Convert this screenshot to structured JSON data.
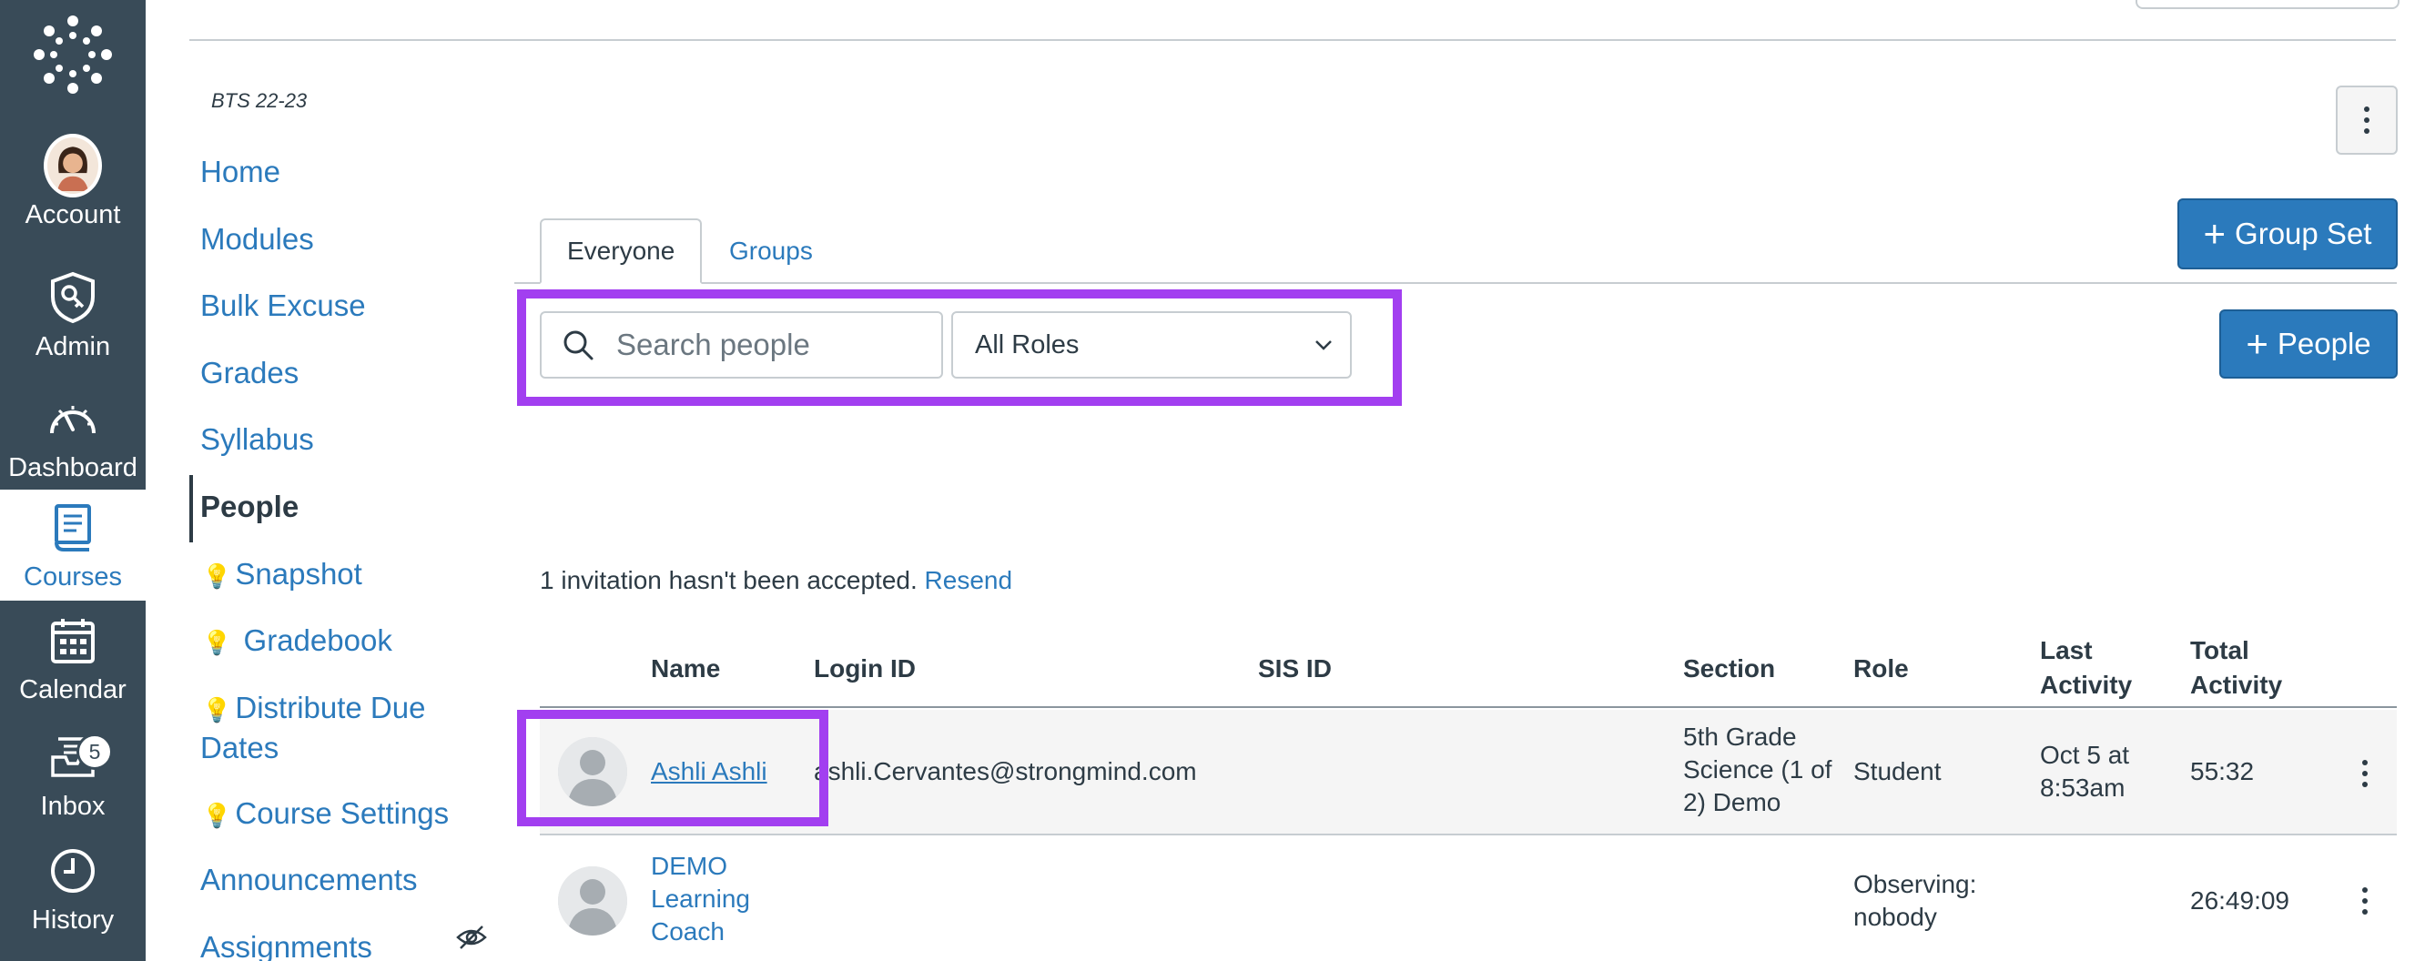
{
  "global_nav": {
    "items": [
      {
        "label": "Account",
        "icon": "avatar"
      },
      {
        "label": "Admin",
        "icon": "admin-shield-icon"
      },
      {
        "label": "Dashboard",
        "icon": "dashboard-gauge-icon"
      },
      {
        "label": "Courses",
        "icon": "courses-book-icon",
        "active": true
      },
      {
        "label": "Calendar",
        "icon": "calendar-icon"
      },
      {
        "label": "Inbox",
        "icon": "inbox-icon",
        "badge": "5"
      },
      {
        "label": "History",
        "icon": "clock-icon"
      }
    ]
  },
  "course": {
    "code": "BTS 22-23",
    "nav": [
      {
        "label": "Home"
      },
      {
        "label": "Modules"
      },
      {
        "label": "Bulk Excuse"
      },
      {
        "label": "Grades"
      },
      {
        "label": "Syllabus"
      },
      {
        "label": "People",
        "active": true
      },
      {
        "label": "Snapshot",
        "bulb": true
      },
      {
        "label": "Gradebook",
        "bulb": true
      },
      {
        "label": "Distribute Due",
        "label2": "Dates",
        "bulb": true
      },
      {
        "label": "Course Settings",
        "bulb": true
      },
      {
        "label": "Announcements"
      },
      {
        "label": "Assignments"
      }
    ]
  },
  "tabs": [
    "Everyone",
    "Groups"
  ],
  "buttons": {
    "group_set": "Group Set",
    "people": "People"
  },
  "search": {
    "placeholder": "Search people",
    "value": ""
  },
  "role_filter": {
    "selected": "All Roles"
  },
  "invitation": {
    "text": "1 invitation hasn't been accepted.",
    "link": "Resend"
  },
  "table": {
    "headers": {
      "name": "Name",
      "login_id": "Login ID",
      "sis_id": "SIS ID",
      "section": "Section",
      "role": "Role",
      "last_activity_1": "Last",
      "last_activity_2": "Activity",
      "total_activity_1": "Total",
      "total_activity_2": "Activity"
    },
    "rows": [
      {
        "name": "Ashli Ashli",
        "login_id": "ashli.Cervantes@strongmind.com",
        "section_1": "5th Grade",
        "section_2": "Science (1 of",
        "section_3": "2) Demo",
        "role": "Student",
        "last_activity_1": "Oct 5 at",
        "last_activity_2": "8:53am",
        "total_activity": "55:32"
      },
      {
        "name_1": "DEMO",
        "name_2": "Learning",
        "name_3": "Coach",
        "role_1": "Observing:",
        "role_2": "nobody",
        "total_activity": "26:49:09"
      }
    ]
  },
  "colors": {
    "nav_bg": "#394b58",
    "link": "#2b7abc",
    "highlight": "#a23ff0",
    "primary_button": "#2b7abc"
  }
}
